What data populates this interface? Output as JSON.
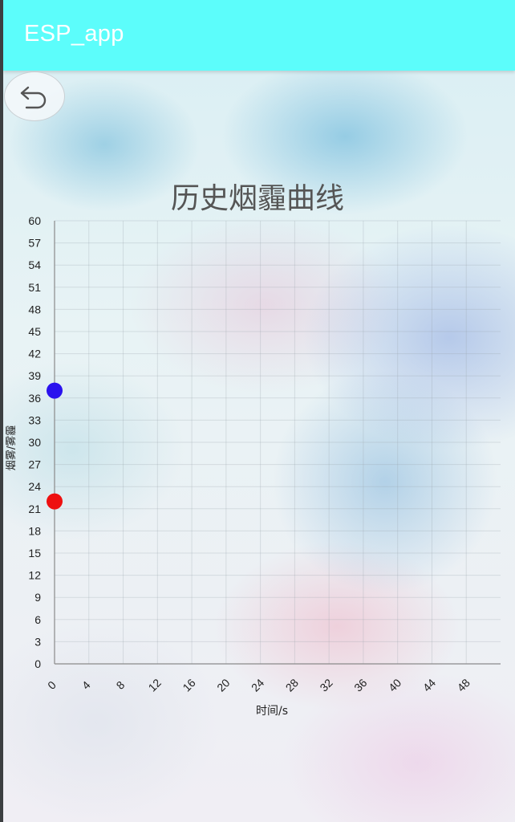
{
  "app": {
    "title": "ESP_app"
  },
  "back_button": {
    "icon": "undo-arrow-icon"
  },
  "chart_data": {
    "type": "scatter",
    "title": "历史烟霾曲线",
    "xlabel": "时间/s",
    "ylabel": "烟雾/雾霾",
    "xlim": [
      0,
      52
    ],
    "ylim": [
      0,
      60
    ],
    "x_ticks": [
      0,
      4,
      8,
      12,
      16,
      20,
      24,
      28,
      32,
      36,
      40,
      44,
      48
    ],
    "y_ticks": [
      0,
      3,
      6,
      9,
      12,
      15,
      18,
      21,
      24,
      27,
      30,
      33,
      36,
      39,
      42,
      45,
      48,
      51,
      54,
      57,
      60
    ],
    "grid": true,
    "series": [
      {
        "values": [
          {
            "x": 0,
            "y": 37
          }
        ],
        "color": "#2a12ee"
      },
      {
        "values": [
          {
            "x": 0,
            "y": 22
          }
        ],
        "color": "#ee1010"
      }
    ]
  }
}
